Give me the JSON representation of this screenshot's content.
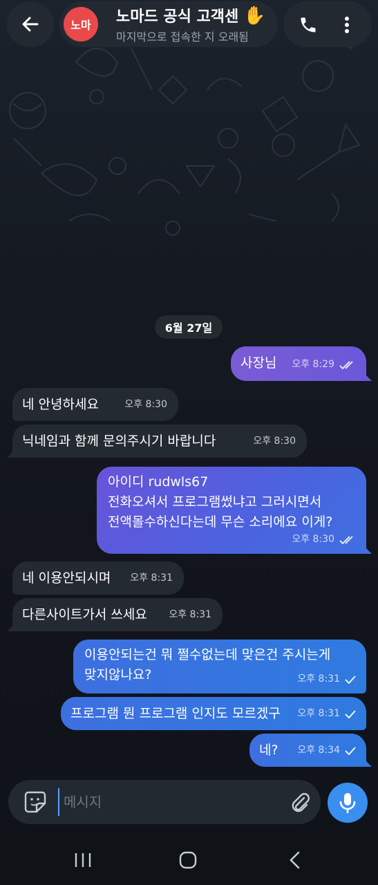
{
  "header": {
    "avatar_text": "노마",
    "title": "노마드 공식 고객센",
    "status": "마지막으로 접속한 지 오래됨",
    "icons": [
      "back-arrow-icon",
      "waving-hand-icon",
      "phone-icon",
      "more-vertical-icon"
    ]
  },
  "date_divider": "6월 27일",
  "messages": [
    {
      "dir": "out",
      "text": "사장님",
      "time": "오후 8:29",
      "status": "read"
    },
    {
      "dir": "in",
      "text": "네 안녕하세요",
      "time": "오후 8:30"
    },
    {
      "dir": "in",
      "text": "닉네임과 함께 문의주시기 바랍니다",
      "time": "오후 8:30"
    },
    {
      "dir": "out",
      "lines": [
        "아이디 rudwls67",
        "전화오셔서 프로그램썼냐고 그러시면서",
        "전액몰수하신다는데 무슨 소리에요 이게?"
      ],
      "time": "오후 8:30",
      "status": "read"
    },
    {
      "dir": "in",
      "text": "네 이용안되시며",
      "time": "오후 8:31"
    },
    {
      "dir": "in",
      "text": "다른사이트가서 쓰세요",
      "time": "오후 8:31"
    },
    {
      "dir": "out",
      "lines": [
        "이용안되는건 뭐 쩔수없는데 맞은건 주시는게",
        "맞지않나요?"
      ],
      "time": "오후 8:31",
      "status": "sent"
    },
    {
      "dir": "out",
      "text": "프로그램 뭔 프로그램 인지도 모르겠구",
      "time": "오후 8:31",
      "status": "sent"
    },
    {
      "dir": "out",
      "text": "네?",
      "time": "오후 8:34",
      "status": "sent"
    }
  ],
  "composer": {
    "placeholder": "메시지",
    "icons": [
      "sticker-icon",
      "paperclip-icon",
      "microphone-icon"
    ]
  },
  "navigation": {
    "icons": [
      "recent-apps-icon",
      "home-icon",
      "back-icon"
    ]
  },
  "colors": {
    "background": "#12151c",
    "incoming_bubble": "#242a32",
    "outgoing_purple": "#7a5bd6",
    "outgoing_blue": "#3d6fe0",
    "avatar": "#e9494b",
    "mic_button": "#3a8ef0"
  }
}
